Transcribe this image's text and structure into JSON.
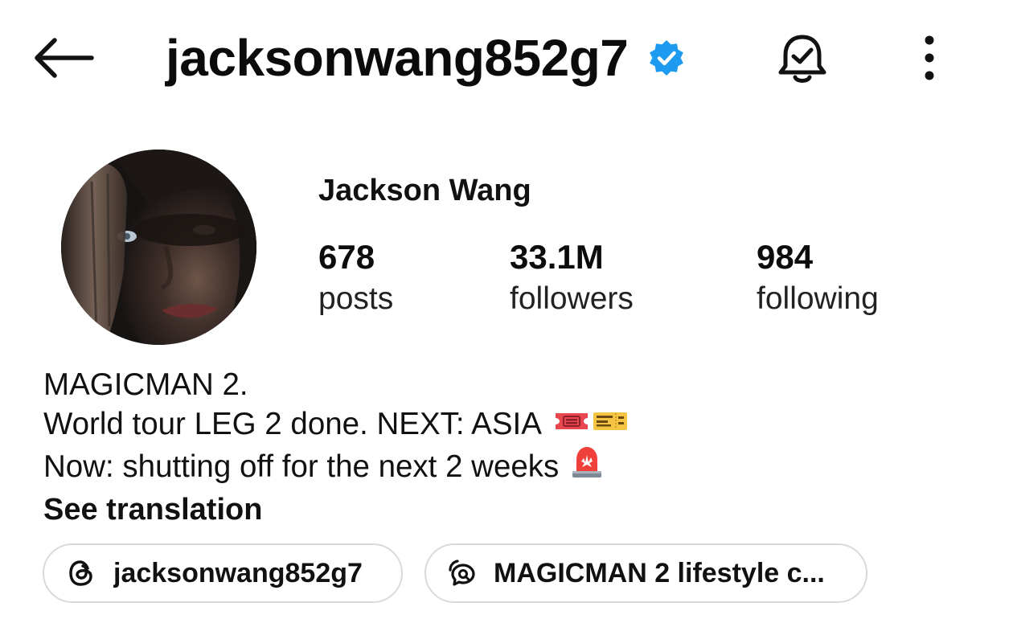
{
  "header": {
    "username": "jacksonwang852g7",
    "verified": true,
    "icons": {
      "back": "arrow-left-icon",
      "verified": "verified-badge-icon",
      "notifications": "bell-check-icon",
      "more": "more-vertical-icon"
    }
  },
  "profile": {
    "display_name": "Jackson Wang",
    "avatar": "profile-photo",
    "stats": {
      "posts": {
        "value": "678",
        "label": "posts"
      },
      "followers": {
        "value": "33.1M",
        "label": "followers"
      },
      "following": {
        "value": "984",
        "label": "following"
      }
    }
  },
  "bio": {
    "line1": "MAGICMAN 2.",
    "line2": "World tour LEG 2 done. NEXT: ASIA",
    "line2_emojis": [
      "ticket-emoji",
      "admission-tickets-emoji"
    ],
    "line3": "Now: shutting off for the next 2 weeks",
    "line3_emojis": [
      "police-light-emoji"
    ],
    "see_translation": "See translation"
  },
  "links": {
    "threads": {
      "icon": "threads-icon",
      "label": "jacksonwang852g7"
    },
    "broadcast": {
      "icon": "broadcast-channel-icon",
      "label": "MAGICMAN 2 lifestyle c..."
    }
  },
  "colors": {
    "verified_blue": "#1d9bf0",
    "text": "#0c0c0c",
    "pill_border": "#dadada",
    "background": "#ffffff"
  }
}
